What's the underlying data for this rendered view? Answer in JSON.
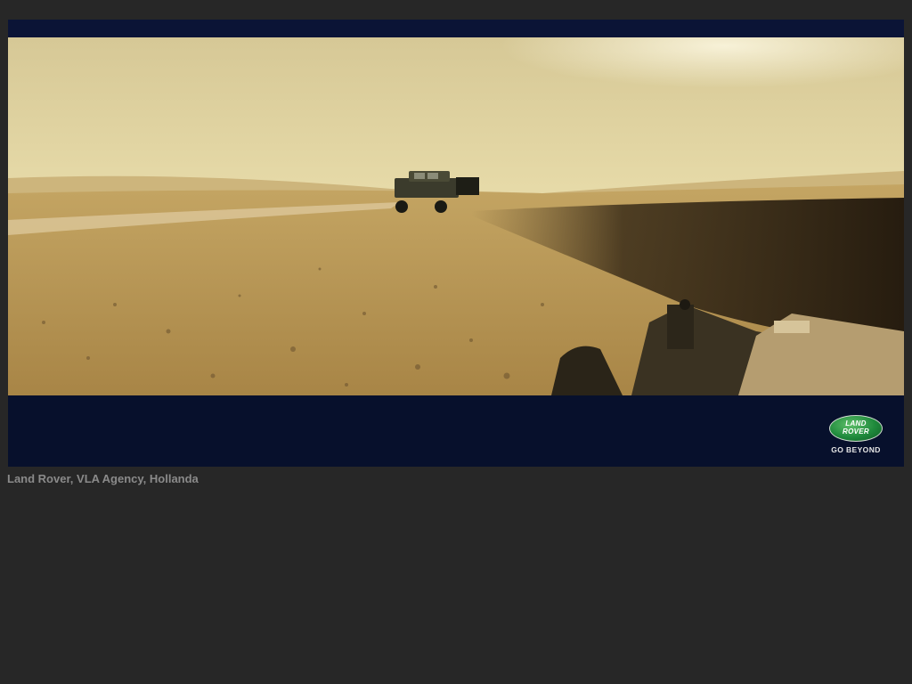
{
  "advert": {
    "image_description_name": "desert-landscape-photo",
    "logo": {
      "brand_line1": "LAND",
      "brand_line2": "ROVER",
      "tagline": "GO BEYOND"
    }
  },
  "caption": "Land Rover, VLA Agency, Hollanda",
  "colors": {
    "page_background": "#272727",
    "band_navy": "#07102c",
    "logo_green": "#1f8a3c",
    "caption_gray": "#8a8a8a"
  }
}
